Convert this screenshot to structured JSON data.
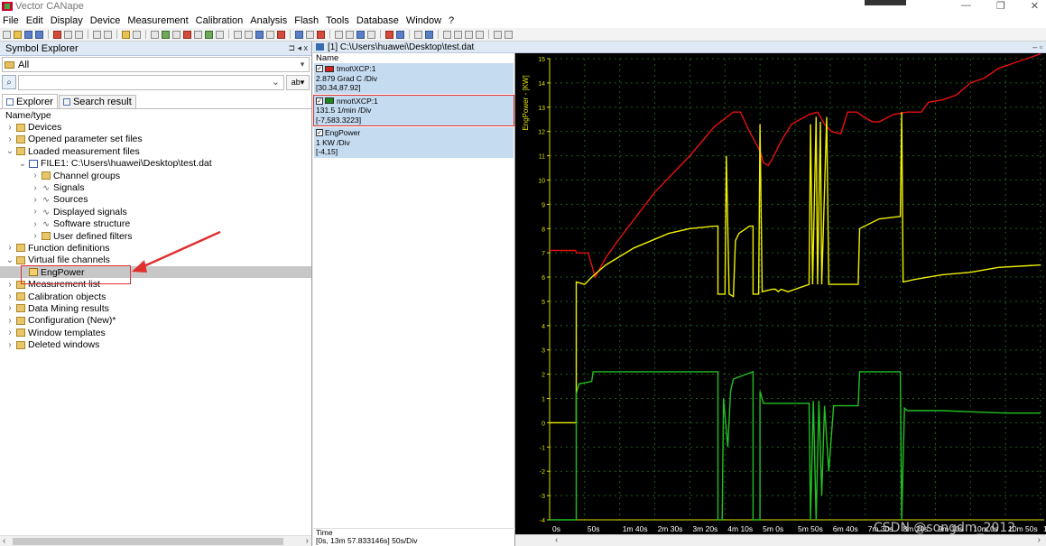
{
  "app": {
    "title": "Vector CANape"
  },
  "menu": [
    "File",
    "Edit",
    "Display",
    "Device",
    "Measurement",
    "Calibration",
    "Analysis",
    "Flash",
    "Tools",
    "Database",
    "Window",
    "?"
  ],
  "symbol_explorer": {
    "title": "Symbol Explorer",
    "header_ctl": "⊐ ◂ x",
    "filter": "All",
    "search_opt": "ab▾",
    "tabs": [
      "Explorer",
      "Search result"
    ],
    "column": "Name/type",
    "tree": [
      {
        "label": "Devices",
        "level": 0,
        "expanded": false,
        "icon": "folder"
      },
      {
        "label": "Opened parameter set files",
        "level": 0,
        "expanded": false,
        "icon": "folder"
      },
      {
        "label": "Loaded measurement files",
        "level": 0,
        "expanded": true,
        "icon": "folder"
      },
      {
        "label": "FILE1: C:\\Users\\huawei\\Desktop\\test.dat",
        "level": 1,
        "expanded": true,
        "icon": "file"
      },
      {
        "label": "Channel groups",
        "level": 2,
        "expanded": false,
        "icon": "folder"
      },
      {
        "label": "Signals",
        "level": 2,
        "expanded": false,
        "icon": "sig"
      },
      {
        "label": "Sources",
        "level": 2,
        "expanded": false,
        "icon": "sig"
      },
      {
        "label": "Displayed signals",
        "level": 2,
        "expanded": false,
        "icon": "sig"
      },
      {
        "label": "Software structure",
        "level": 2,
        "expanded": false,
        "icon": "sig"
      },
      {
        "label": "User defined filters",
        "level": 2,
        "expanded": false,
        "icon": "folder"
      },
      {
        "label": "Function definitions",
        "level": 0,
        "expanded": false,
        "icon": "folder"
      },
      {
        "label": "Virtual file channels",
        "level": 0,
        "expanded": true,
        "icon": "folder"
      },
      {
        "label": "EngPower",
        "level": 1,
        "expanded": null,
        "icon": "ep",
        "selected": true
      },
      {
        "label": "Measurement list",
        "level": 0,
        "expanded": false,
        "icon": "folder"
      },
      {
        "label": "Calibration objects",
        "level": 0,
        "expanded": false,
        "icon": "folder"
      },
      {
        "label": "Data Mining results",
        "level": 0,
        "expanded": false,
        "icon": "folder"
      },
      {
        "label": "Configuration (New)*",
        "level": 0,
        "expanded": false,
        "icon": "folder"
      },
      {
        "label": "Window templates",
        "level": 0,
        "expanded": false,
        "icon": "folder"
      },
      {
        "label": "Deleted windows",
        "level": 0,
        "expanded": false,
        "icon": "folder"
      }
    ]
  },
  "graphic_window": {
    "title": "[1] C:\\Users\\huawei\\Desktop\\test.dat",
    "header_ctl": "– ▫",
    "name_header": "Name",
    "time_label": "Time",
    "time_value": "[0s, 13m 57.833146s] 50s/Div",
    "channels": [
      {
        "name": "tmot\\XCP:1",
        "scale": "2.879 Grad C /Div",
        "range": "[30.34,87.92]",
        "color": "#d02020"
      },
      {
        "name": "nmot\\XCP:1",
        "scale": "131.5 1/min /Div",
        "range": "[-7,583.3223]",
        "color": "#1a8a1a"
      },
      {
        "name": "EngPower",
        "scale": "1 KW /Div",
        "range": "[-4,15]",
        "color": "#e0e000"
      }
    ]
  },
  "chart": {
    "y_axis_label": "EngPower - [KW]",
    "y_ticks": [
      "15",
      "14",
      "13",
      "12",
      "11",
      "10",
      "9",
      "8",
      "7",
      "6",
      "5",
      "4",
      "3",
      "2",
      "1",
      "0",
      "-1",
      "-2",
      "-3",
      "-4"
    ],
    "x_ticks": [
      "0s",
      "50s",
      "1m 40s",
      "2m 30s",
      "3m 20s",
      "4m 10s",
      "5m 0s",
      "5m 50s",
      "6m 40s",
      "7m 30s",
      "8m 20s",
      "9m 10s",
      "10m 0s",
      "10m 50s",
      "11m 40s"
    ],
    "colors": {
      "background": "#000000",
      "grid": "#1f5f1f",
      "red": "#e81010",
      "yellow": "#f0f000",
      "green": "#22c022",
      "axis": "#e0e000"
    }
  },
  "watermark": "CSDN @songdm_2012"
}
